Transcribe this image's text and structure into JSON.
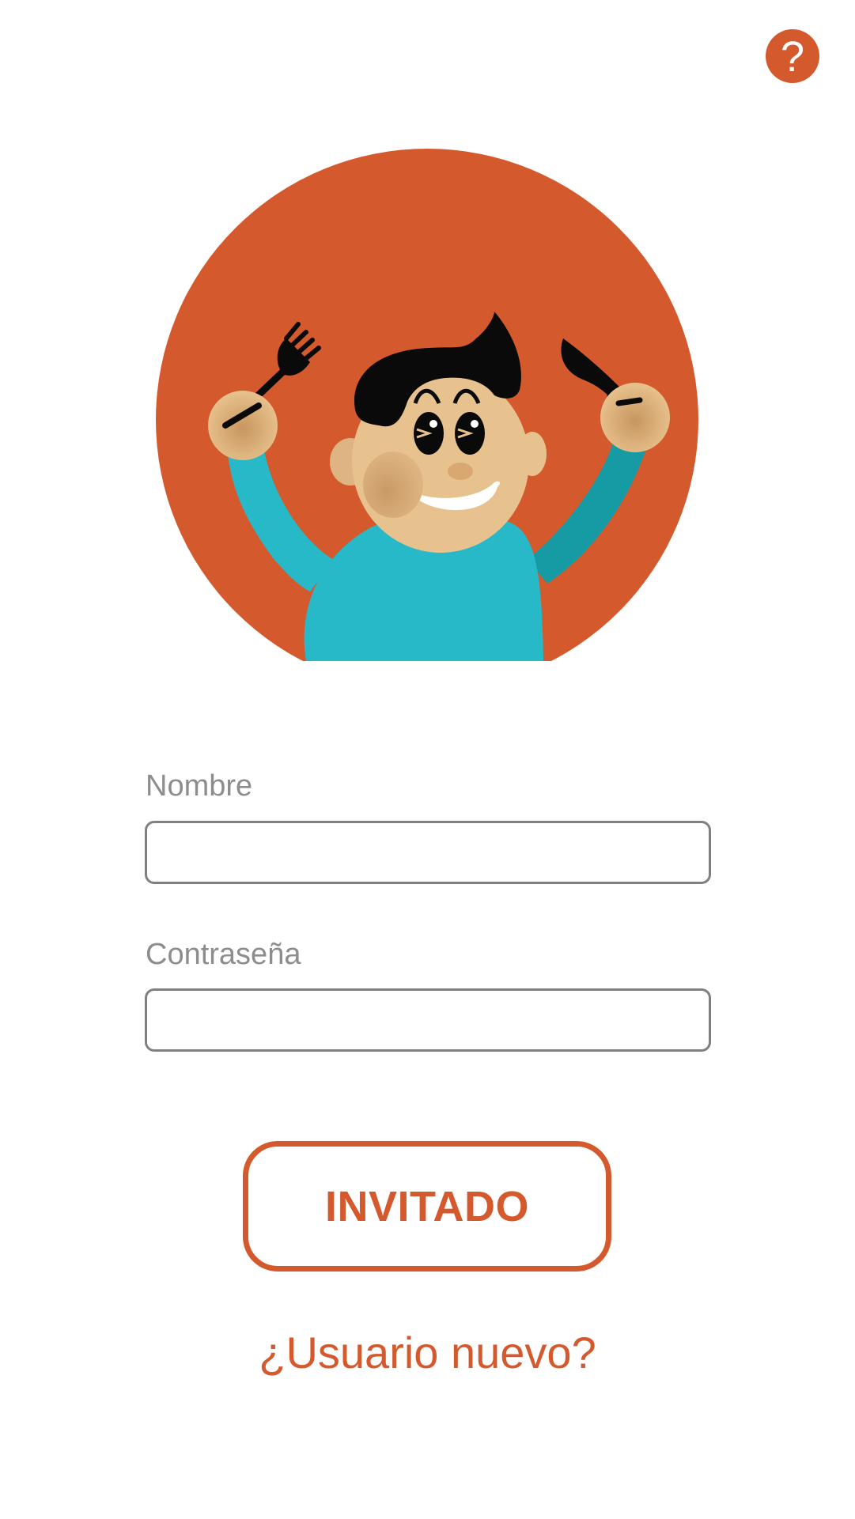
{
  "header": {
    "help_icon": "question-mark-icon",
    "help_glyph": "?"
  },
  "hero": {
    "illustration": "hungry-boy-with-fork-and-knife"
  },
  "form": {
    "username_label": "Nombre",
    "username_value": "",
    "password_label": "Contraseña",
    "password_value": ""
  },
  "actions": {
    "guest_label": "INVITADO",
    "new_user_label": "¿Usuario nuevo?"
  },
  "colors": {
    "accent": "#d45a2e",
    "shirt": "#27b9c8",
    "skin": "#e8c28e",
    "field_border": "#808080",
    "label_text": "#8d8d8d"
  }
}
